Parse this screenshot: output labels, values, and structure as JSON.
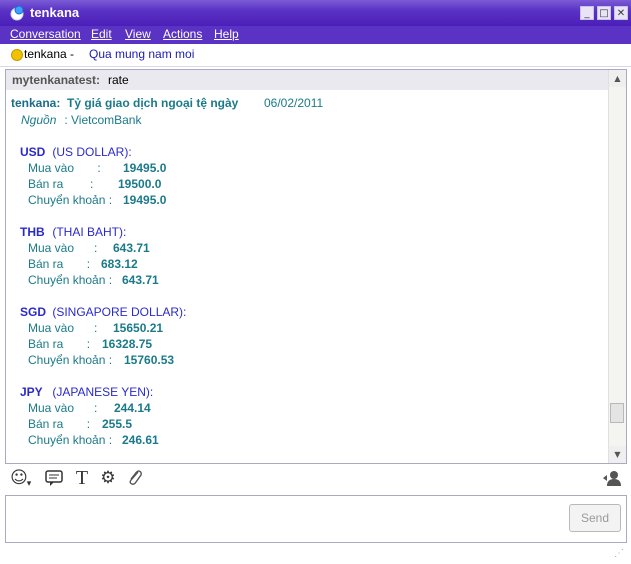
{
  "window": {
    "title": "tenkana"
  },
  "menu": [
    "Conversation",
    "Edit",
    "View",
    "Actions",
    "Help"
  ],
  "status": {
    "name": "tenkana",
    "separator": " - ",
    "message": "Qua mung nam moi"
  },
  "incoming": {
    "sender": "mytenkanatest:",
    "text": "rate"
  },
  "reply": {
    "sender": "tenkana:",
    "heading": "Tỷ giá giao dịch ngoại tệ ngày",
    "date": "06/02/2011",
    "source_label": "Nguồn",
    "source_value": " : VietcomBank",
    "currencies": [
      {
        "code": "USD",
        "name": " (US DOLLAR):",
        "buy_label": "Mua vào       :",
        "buy": "19495.0",
        "sell_label": "Bán ra        :",
        "sell": "19500.0",
        "transfer_label": "Chuyển khoản :",
        "transfer": "19495.0"
      },
      {
        "code": "THB",
        "name": " (THAI BAHT):",
        "buy_label": "Mua vào      :",
        "buy": "643.71",
        "sell_label": "Bán ra       :",
        "sell": "683.12",
        "transfer_label": "Chuyển khoản :",
        "transfer": "643.71"
      },
      {
        "code": "SGD",
        "name": " (SINGAPORE DOLLAR):",
        "buy_label": "Mua vào      :",
        "buy": "15650.21",
        "sell_label": "Bán ra       :",
        "sell": "16328.75",
        "transfer_label": "Chuyển khoản :",
        "transfer": "15760.53"
      },
      {
        "code": "JPY",
        "name": " (JAPANESE YEN):",
        "buy_label": "Mua vào      :",
        "buy": "244.14",
        "sell_label": "Bán ra       :",
        "sell": "255.5",
        "transfer_label": "Chuyển khoản :",
        "transfer": "246.61"
      }
    ]
  },
  "toolbar": {
    "icons": [
      "emoticon-icon",
      "nudge-icon",
      "font-icon",
      "settings-icon",
      "attach-icon",
      "contact-icon"
    ]
  },
  "input": {
    "value": "",
    "send_label": "Send"
  },
  "colors": {
    "titlebar": "#5a32c4",
    "teal_text": "#1b7a8a",
    "code_blue": "#2a2acb"
  }
}
